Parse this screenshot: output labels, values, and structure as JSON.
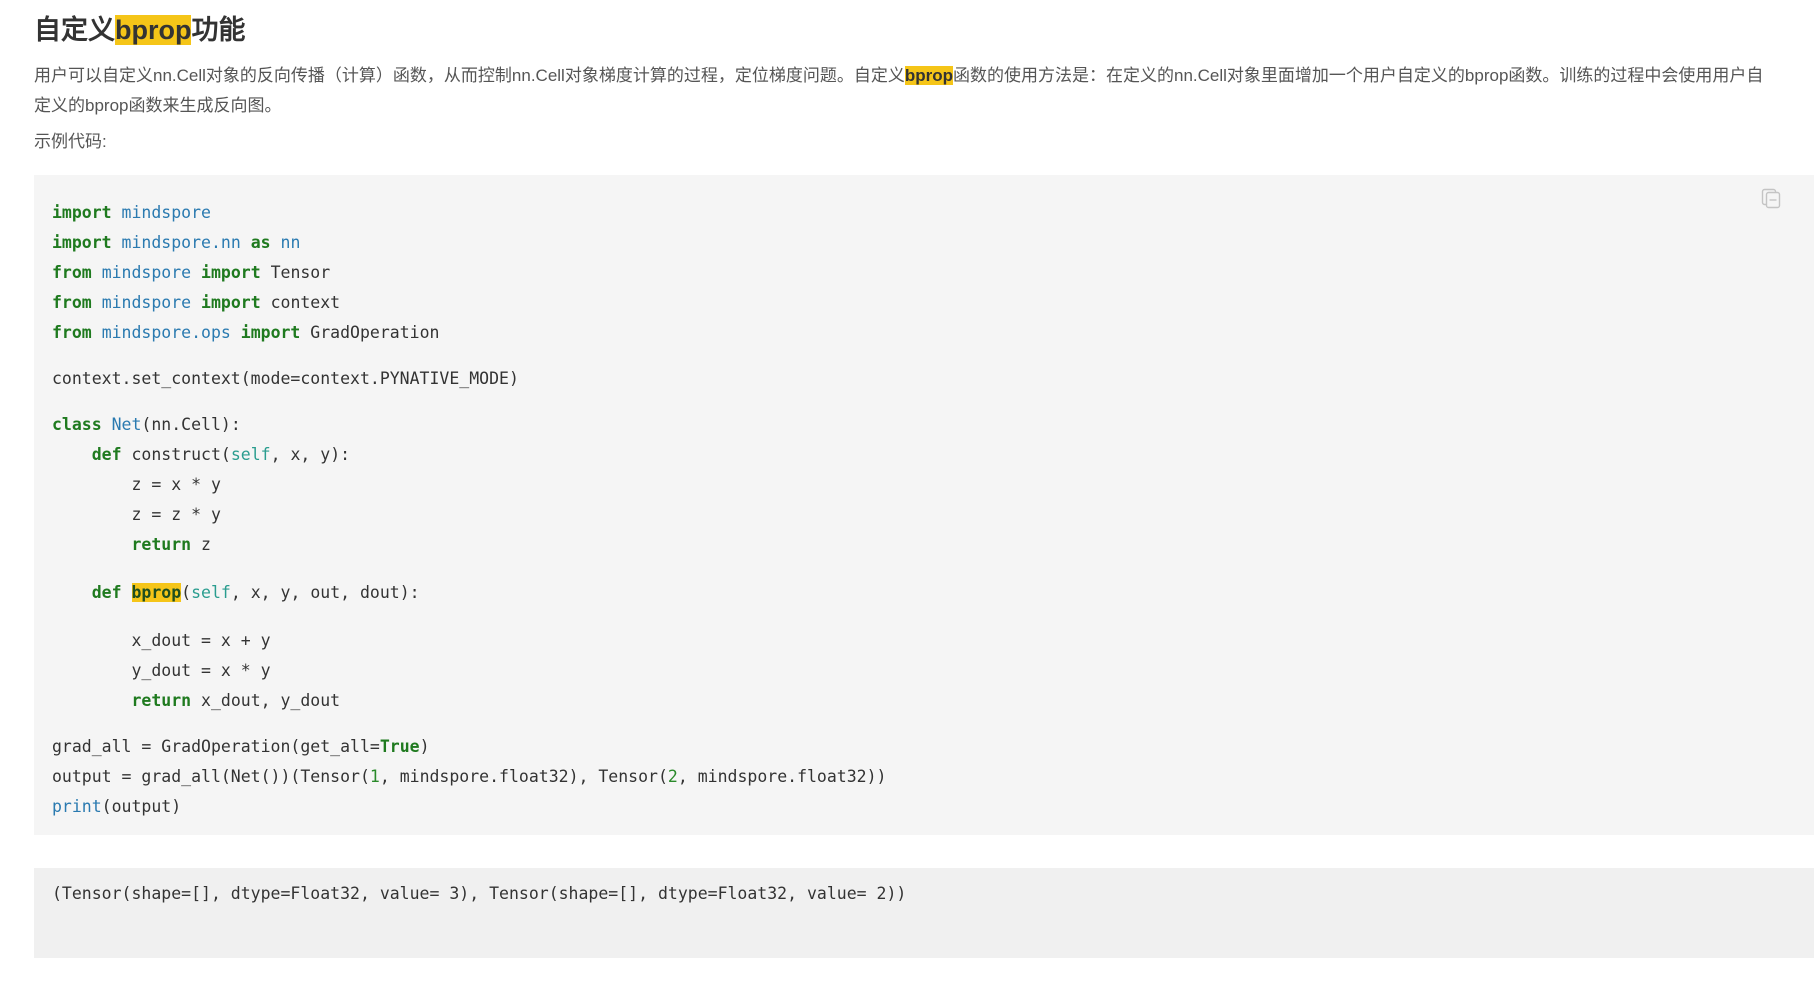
{
  "title": {
    "prefix": "自定义",
    "highlight": "bprop",
    "suffix": "功能"
  },
  "description": {
    "line1_part1": "用户可以自定义nn.Cell对象的反向传播（计算）函数，从而控制nn.Cell对象梯度计算的过程，定位梯度问题。自定义",
    "line1_highlight": "bprop",
    "line1_part2": "函数的使用方法是：在定义的nn.Cell对象里面增加一个用户自定义的bprop函数。训练的过程中会使用用户自",
    "line2": "定义的bprop函数来生成反向图。"
  },
  "example_label": "示例代码:",
  "code": {
    "import_kw": "import",
    "from_kw": "from",
    "as_kw": "as",
    "mod_mindspore": "mindspore",
    "mod_mindspore_nn": "mindspore.nn",
    "alias_nn": "nn",
    "mod_mindspore_ops": "mindspore.ops",
    "name_tensor": " Tensor",
    "name_context": " context",
    "name_gradop": " GradOperation",
    "set_context_line": "context.set_context(mode=context.PYNATIVE_MODE)",
    "class_kw": "class",
    "class_name": "Net",
    "class_base": "(nn.Cell):",
    "def_kw": "def",
    "construct_name": " construct(",
    "self_kw": "self",
    "construct_args": ", x, y):",
    "z1": "z = x * y",
    "z2": "z = z * y",
    "return_kw": "return",
    "return_z": " z",
    "bprop_name": "bprop",
    "bprop_args": ", x, y, out, dout):",
    "xdout": "x_dout = x + y",
    "ydout": "y_dout = x * y",
    "return_dout": " x_dout, y_dout",
    "grad_all_line_a": "grad_all = GradOperation(get_all=",
    "true_kw": "True",
    "grad_all_line_b": ")",
    "output_line_a": "output = grad_all(Net())(Tensor(",
    "num1": "1",
    "output_line_b": ", mindspore.float32), Tensor(",
    "num2": "2",
    "output_line_c": ", mindspore.float32))",
    "print_kw": "print",
    "print_args": "(output)"
  },
  "output_text": "(Tensor(shape=[], dtype=Float32, value= 3), Tensor(shape=[], dtype=Float32, value= 2))",
  "copy_icon": "copy-icon"
}
